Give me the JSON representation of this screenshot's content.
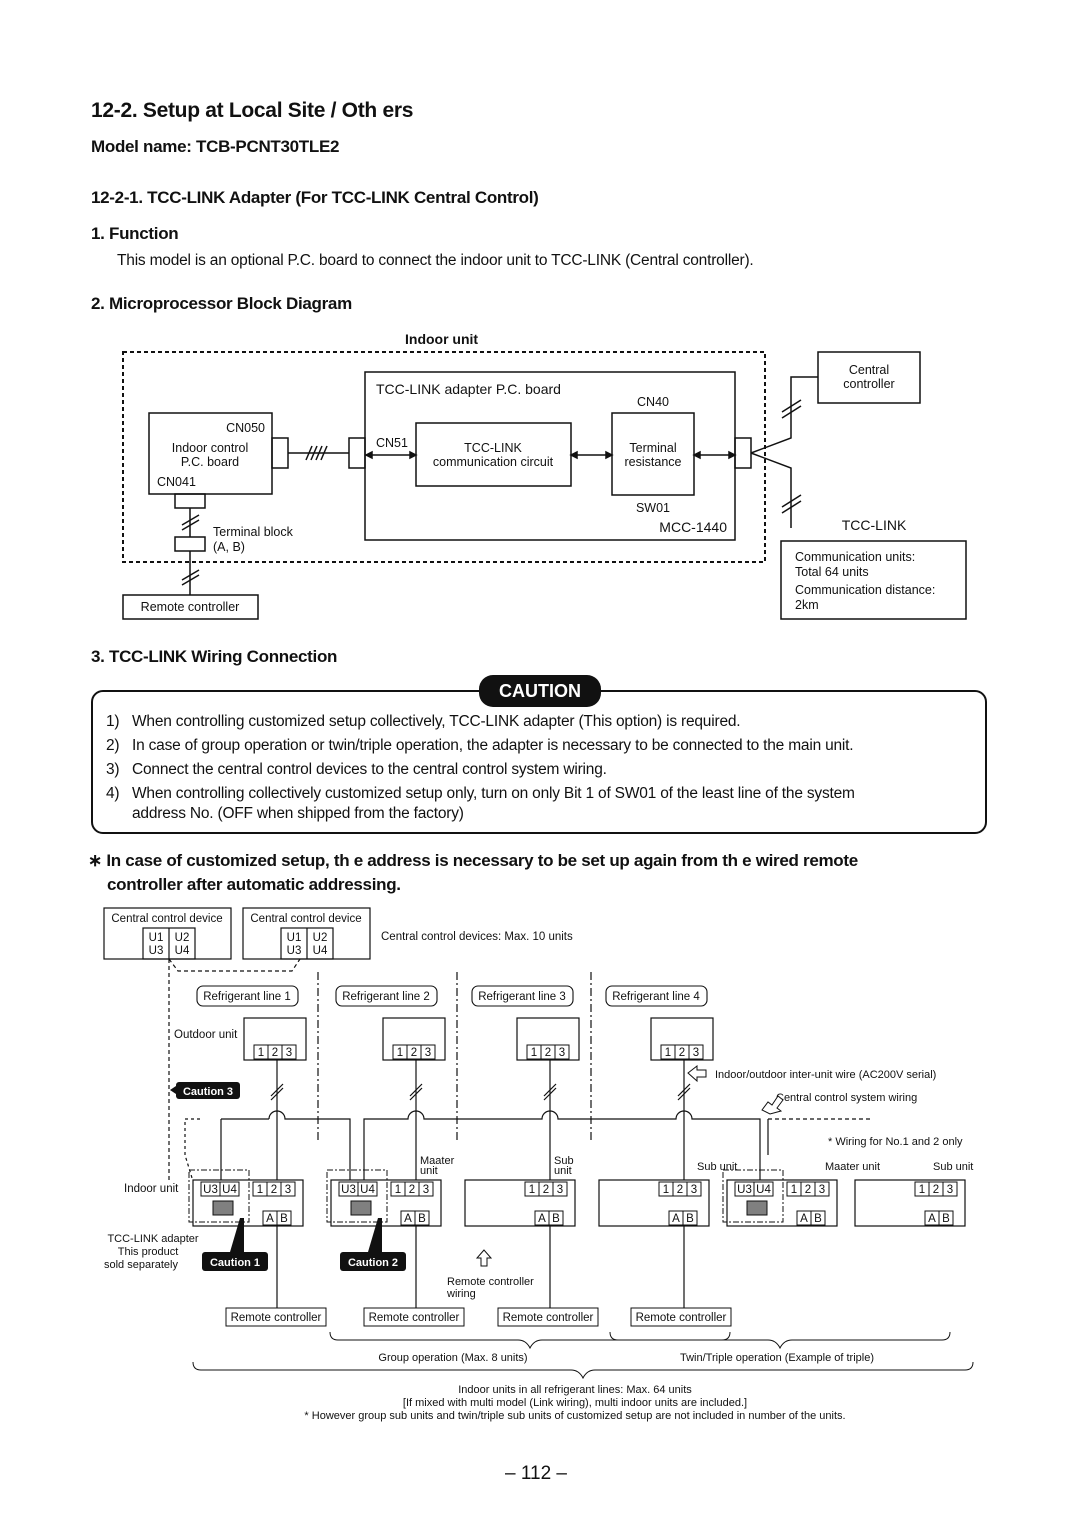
{
  "section": {
    "title": "12-2.  Setup at Local Site / Oth  ers",
    "model_name": "Model name: TCB-PCNT30TLE2",
    "subsection_title": "12-2-1.  TCC-LINK Adapter (For TCC-LINK Central Control)"
  },
  "function": {
    "heading": "1.  Function",
    "text": "This model is an optional P.C. board to connect the indoor unit to TCC-LINK (Central controller)."
  },
  "block_diagram": {
    "heading": "2.  Microprocessor Block   Diagram",
    "indoor_unit_label": "Indoor unit",
    "indoor_control_board": [
      "Indoor control",
      "P.C. board"
    ],
    "cn050": "CN050",
    "cn041": "CN041",
    "terminal_block": [
      "Terminal block",
      "(A, B)"
    ],
    "remote_controller": "Remote controller",
    "adapter_board_label": "TCC-LINK adapter P.C. board",
    "cn51": "CN51",
    "comm_circuit": [
      "TCC-LINK",
      "communication circuit"
    ],
    "cn40": "CN40",
    "terminal_resistance": [
      "Terminal",
      "resistance"
    ],
    "sw01": "SW01",
    "mcc": "MCC-1440",
    "central_controller": [
      "Central",
      "controller"
    ],
    "tcc_link": "TCC-LINK",
    "info": [
      "Communication units:",
      "Total 64 units",
      "Communication distance:",
      "2km"
    ]
  },
  "wiring": {
    "heading": "3.  TCC-LINK Wiring Connection",
    "caution_label": "CAUTION",
    "caution_items": [
      {
        "num": "1)",
        "text": "When controlling customized setup collectively, TCC-LINK adapter (This option) is required."
      },
      {
        "num": "2)",
        "text": "In case of group operation or twin/triple operation, the adapter is necessary to be connected to the main unit."
      },
      {
        "num": "3)",
        "text": "Connect the central control devices to the central control system wiring."
      },
      {
        "num": "4)",
        "text": "When controlling collectively customized setup only, turn on only Bit 1 of SW01 of the least line of the system"
      },
      {
        "num": "",
        "text": "address No. (OFF when shipped from the factory)"
      }
    ],
    "note_line1": "∗ In case of customized setup,  th  e address is necessary   to be set up again from th  e wired remote",
    "note_line2": "controller after automatic addressing."
  },
  "system_diagram": {
    "central_device": "Central control device",
    "terminals_top": [
      "U1",
      "U2"
    ],
    "terminals_bottom": [
      "U3",
      "U4"
    ],
    "central_max": "Central control devices: Max. 10 units",
    "refrigerant_lines": [
      "Refrigerant line 1",
      "Refrigerant line 2",
      "Refrigerant line 3",
      "Refrigerant line 4"
    ],
    "outdoor_unit": "Outdoor unit",
    "terminals_123": [
      "1",
      "2",
      "3"
    ],
    "terminals_ab": [
      "A",
      "B"
    ],
    "inter_unit_wire": "Indoor/outdoor inter-unit wire (AC200V serial)",
    "central_wiring": "Central control system wiring",
    "wiring_note": "* Wiring for No.1 and 2 only",
    "caution_tags": [
      "Caution 1",
      "Caution 2",
      "Caution 3"
    ],
    "indoor_unit": "Indoor unit",
    "adapter_note": [
      "TCC-LINK adapter",
      "This product",
      "sold separately"
    ],
    "master_unit": [
      "Maater",
      "unit"
    ],
    "sub_unit": [
      "Sub",
      "unit"
    ],
    "sub_unit_inline": "Sub unit",
    "master_unit_inline": "Maater unit",
    "remote_controller": "Remote controller",
    "remote_wiring": [
      "Remote controller",
      "wiring"
    ],
    "group_operation": "Group operation (Max. 8 units)",
    "twin_triple": "Twin/Triple operation (Example of triple)",
    "footer": [
      "Indoor units in all refrigerant lines: Max. 64 units",
      "[If mixed with multi model (Link wiring), multi indoor units are included.]",
      "* However group sub units and twin/triple sub units of customized setup are not included in number of the units."
    ]
  },
  "page_number": "– 112 –"
}
